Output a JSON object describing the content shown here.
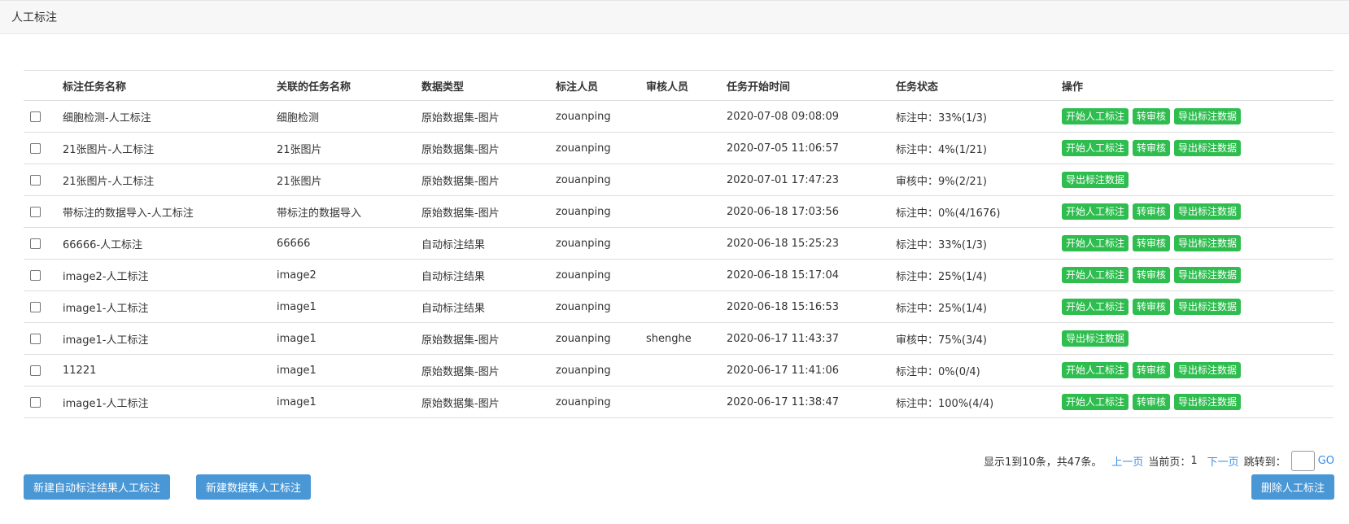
{
  "header": {
    "title": "人工标注"
  },
  "table": {
    "columns": [
      "标注任务名称",
      "关联的任务名称",
      "数据类型",
      "标注人员",
      "审核人员",
      "任务开始时间",
      "任务状态",
      "操作"
    ],
    "rows": [
      {
        "name": "细胞检测-人工标注",
        "related": "细胞检测",
        "type": "原始数据集-图片",
        "annotator": "zouanping",
        "reviewer": "",
        "start": "2020-07-08 09:08:09",
        "status": "标注中：33%(1/3)",
        "ops": [
          "开始人工标注",
          "转审核",
          "导出标注数据"
        ]
      },
      {
        "name": "21张图片-人工标注",
        "related": "21张图片",
        "type": "原始数据集-图片",
        "annotator": "zouanping",
        "reviewer": "",
        "start": "2020-07-05 11:06:57",
        "status": "标注中：4%(1/21)",
        "ops": [
          "开始人工标注",
          "转审核",
          "导出标注数据"
        ]
      },
      {
        "name": "21张图片-人工标注",
        "related": "21张图片",
        "type": "原始数据集-图片",
        "annotator": "zouanping",
        "reviewer": "",
        "start": "2020-07-01 17:47:23",
        "status": "审核中：9%(2/21)",
        "ops": [
          "导出标注数据"
        ]
      },
      {
        "name": "带标注的数据导入-人工标注",
        "related": "带标注的数据导入",
        "type": "原始数据集-图片",
        "annotator": "zouanping",
        "reviewer": "",
        "start": "2020-06-18 17:03:56",
        "status": "标注中：0%(4/1676)",
        "ops": [
          "开始人工标注",
          "转审核",
          "导出标注数据"
        ]
      },
      {
        "name": "66666-人工标注",
        "related": "66666",
        "type": "自动标注结果",
        "annotator": "zouanping",
        "reviewer": "",
        "start": "2020-06-18 15:25:23",
        "status": "标注中：33%(1/3)",
        "ops": [
          "开始人工标注",
          "转审核",
          "导出标注数据"
        ]
      },
      {
        "name": "image2-人工标注",
        "related": "image2",
        "type": "自动标注结果",
        "annotator": "zouanping",
        "reviewer": "",
        "start": "2020-06-18 15:17:04",
        "status": "标注中：25%(1/4)",
        "ops": [
          "开始人工标注",
          "转审核",
          "导出标注数据"
        ]
      },
      {
        "name": "image1-人工标注",
        "related": "image1",
        "type": "自动标注结果",
        "annotator": "zouanping",
        "reviewer": "",
        "start": "2020-06-18 15:16:53",
        "status": "标注中：25%(1/4)",
        "ops": [
          "开始人工标注",
          "转审核",
          "导出标注数据"
        ]
      },
      {
        "name": "image1-人工标注",
        "related": "image1",
        "type": "原始数据集-图片",
        "annotator": "zouanping",
        "reviewer": "shenghe",
        "start": "2020-06-17 11:43:37",
        "status": "审核中：75%(3/4)",
        "ops": [
          "导出标注数据"
        ]
      },
      {
        "name": "11221",
        "related": "image1",
        "type": "原始数据集-图片",
        "annotator": "zouanping",
        "reviewer": "",
        "start": "2020-06-17 11:41:06",
        "status": "标注中：0%(0/4)",
        "ops": [
          "开始人工标注",
          "转审核",
          "导出标注数据"
        ]
      },
      {
        "name": "image1-人工标注",
        "related": "image1",
        "type": "原始数据集-图片",
        "annotator": "zouanping",
        "reviewer": "",
        "start": "2020-06-17 11:38:47",
        "status": "标注中：100%(4/4)",
        "ops": [
          "开始人工标注",
          "转审核",
          "导出标注数据"
        ]
      }
    ]
  },
  "pagination": {
    "summary": "显示1到10条，共47条。",
    "prev": "上一页",
    "current_label": "当前页：",
    "current_page": "1",
    "next": "下一页",
    "jump_label": "跳转到：",
    "go": "GO"
  },
  "actions": {
    "new_auto": "新建自动标注结果人工标注",
    "new_dataset": "新建数据集人工标注",
    "delete": "删除人工标注"
  },
  "colors": {
    "op_button": "#2ebd4e",
    "action_button": "#4a97d6",
    "link": "#3a8ee6"
  }
}
